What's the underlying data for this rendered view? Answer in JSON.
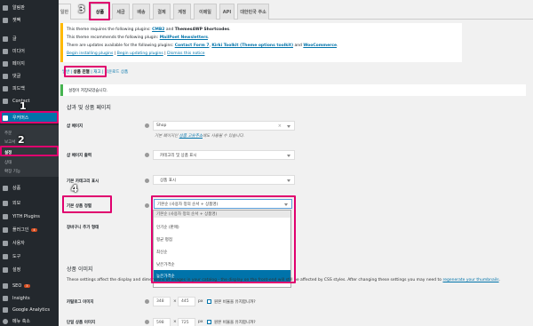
{
  "sidebar": {
    "items": [
      {
        "label": "알림판",
        "top": 0
      },
      {
        "label": "젯팩",
        "top": 0
      },
      {
        "label": "글",
        "top": 0
      },
      {
        "label": "미디어",
        "top": 0
      },
      {
        "label": "페이지",
        "top": 0
      },
      {
        "label": "댓글",
        "top": 0
      },
      {
        "label": "피드백",
        "top": 0
      },
      {
        "label": "Contact",
        "top": 0
      },
      {
        "label": "우커머스",
        "top": 0
      }
    ],
    "subitems": [
      "주문",
      "보고서",
      "설정",
      "상태",
      "확장 기능"
    ],
    "items2": [
      "상품",
      "외모",
      "YITH Plugins",
      "플러그인",
      "사용자",
      "도구",
      "설정",
      "SEO",
      "Insights",
      "Google Analytics",
      "메뉴 축소"
    ],
    "plugin_badge": "4",
    "seo_badge": "3"
  },
  "tabs": [
    "일반",
    "상품",
    "세금",
    "배송",
    "결제",
    "계정",
    "이메일",
    "API",
    "대한민국 주소"
  ],
  "notice": {
    "line1_pre": "This theme requires the following plugins: ",
    "line1_b": "CMB2",
    "line1_mid": " and ",
    "line1_b2": "Themes4WP Shortcodes",
    "line2_pre": "This theme recommends the following plugin: ",
    "line2_b": "MailPoet Newsletters",
    "line3_pre": "There are updates available for the following plugins: ",
    "line3_b": "Contact Form 7",
    "line3_mid": ", ",
    "line3_b2": "Kirki Toolkit (Theme options toolkit)",
    "line3_mid2": " and ",
    "line3_b3": "WooCommerce",
    "link1": "Begin installing plugins",
    "link2": "Begin updating plugins",
    "link3": "Dismiss this notice"
  },
  "subnav": {
    "first": "일반",
    "current": "상품 진열",
    "third": "재고",
    "fourth": "다운로드 상품"
  },
  "success_message": "설정이 저장되었습니다.",
  "section1_title": "샵과 및 상품 페이지",
  "fields": {
    "shop_page": {
      "label": "샵 페이지",
      "value": "Shop",
      "desc_pre": "기본 페이지인 ",
      "desc_link": "상품 고유주소",
      "desc_post": "에도 사용될 수 있습니다."
    },
    "shop_display": {
      "label": "샵 페이지 출력",
      "value": "카테고리 및 상품 표시"
    },
    "category_display": {
      "label": "기본 카테고리 표시",
      "value": "상품 표시"
    },
    "default_sorting": {
      "label": "기본 상품 정렬",
      "value": "기본순 (사용자 정의 순서 + 상품명)"
    },
    "cart_behaviour": {
      "label": "장바구니 추가 형태"
    }
  },
  "dropdown_options": [
    "기본순 (사용자 정의 순서 + 상품명)",
    "인기순 (판매)",
    "평균 평점",
    "최신순",
    "낮은가격순",
    "높은가격순"
  ],
  "section2_title": "상품 이미지",
  "section2_desc": "These settings affect the display and dimensions of images in your catalog - the display on the front-end will still be affected by CSS styles. After changing these settings you may need to",
  "section2_link": "regenerate your thumbnails",
  "catalog": {
    "label": "카탈로그 이미지",
    "w": "348",
    "h": "445",
    "unit": "px",
    "check": "원본 비율을 유지합니까?"
  },
  "single": {
    "label": "단일 상품 이미지",
    "w": "598",
    "h": "725",
    "unit": "px",
    "check": "원본 비율을 유지합니까?"
  },
  "steps": [
    "1",
    "2",
    "3",
    "4"
  ],
  "colors": {
    "accent": "#0073aa",
    "highlight": "#e0006e",
    "sidebar": "#23282d"
  }
}
